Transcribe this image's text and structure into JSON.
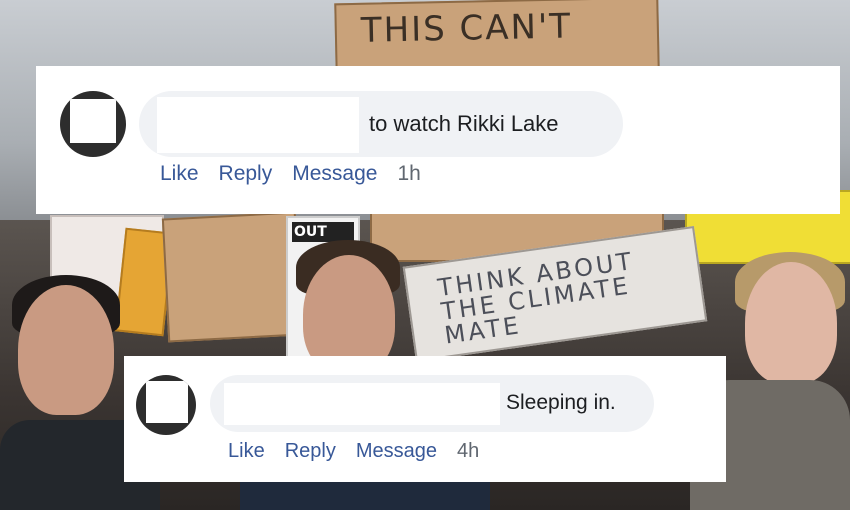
{
  "background": {
    "signs": {
      "top": "THIS CAN'T",
      "out": "OUT",
      "climate": "THINK ABOUT THE CLIMATE MATE"
    }
  },
  "comments": [
    {
      "text": "to watch Rikki Lake",
      "actions": {
        "like": "Like",
        "reply": "Reply",
        "message": "Message"
      },
      "time": "1h"
    },
    {
      "text": "Sleeping in.",
      "actions": {
        "like": "Like",
        "reply": "Reply",
        "message": "Message"
      },
      "time": "4h"
    }
  ],
  "colors": {
    "link": "#385898",
    "bubble": "#f0f2f5",
    "meta": "#606770",
    "text": "#1c1e21"
  }
}
